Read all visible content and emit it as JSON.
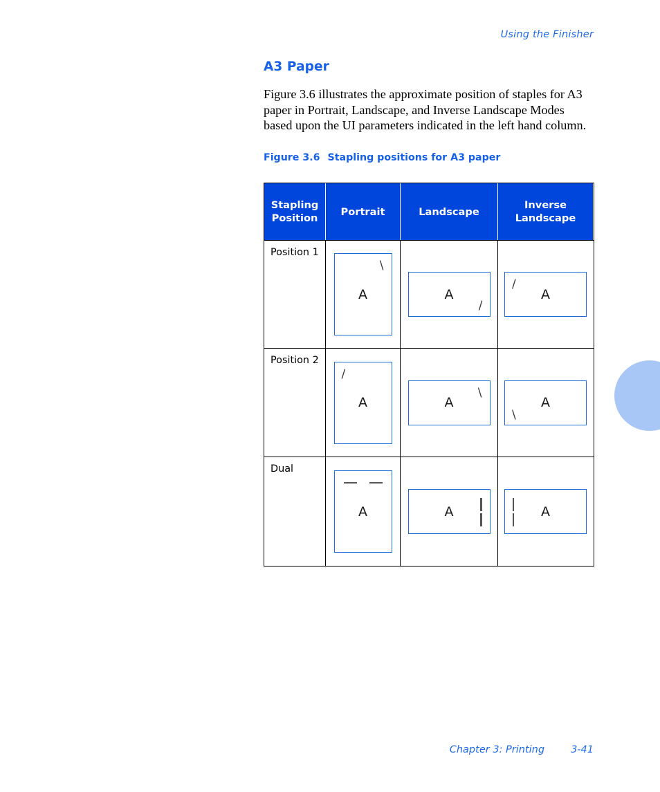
{
  "page": {
    "running_header": "Using the Finisher",
    "heading": "A3 Paper",
    "body": "Figure 3.6 illustrates the approximate position of staples for A3 paper in Portrait, Landscape, and Inverse Landscape Modes based upon the UI parameters indicated in the left hand column.",
    "figure_caption": {
      "number": "Figure 3.6",
      "title": "Stapling positions for A3 paper"
    },
    "footer": {
      "chapter": "Chapter 3: Printing",
      "page_number": "3-41"
    }
  },
  "colors": {
    "heading_blue": "#1661e8",
    "header_band_blue": "#0046dd",
    "sheet_border_blue": "#1a6fd4",
    "margin_circle_blue": "#a9c7f6",
    "staple_gray": "#555555",
    "table_border": "#000000"
  },
  "table": {
    "columns": [
      {
        "label": "Stapling Position"
      },
      {
        "label": "Portrait"
      },
      {
        "label": "Landscape"
      },
      {
        "label": "Inverse Landscape"
      }
    ],
    "rows": [
      {
        "label": "Position 1",
        "portrait": {
          "orientation": "portrait",
          "letter": "A",
          "staples": [
            {
              "glyph": "\\",
              "position": "top-right"
            }
          ]
        },
        "landscape": {
          "orientation": "landscape",
          "letter": "A",
          "staples": [
            {
              "glyph": "/",
              "position": "bottom-right"
            }
          ]
        },
        "inverse": {
          "orientation": "landscape",
          "letter": "A",
          "staples": [
            {
              "glyph": "/",
              "position": "top-left"
            }
          ]
        }
      },
      {
        "label": "Position 2",
        "portrait": {
          "orientation": "portrait",
          "letter": "A",
          "staples": [
            {
              "glyph": "/",
              "position": "top-left"
            }
          ]
        },
        "landscape": {
          "orientation": "landscape",
          "letter": "A",
          "staples": [
            {
              "glyph": "\\",
              "position": "top-right"
            }
          ]
        },
        "inverse": {
          "orientation": "landscape",
          "letter": "A",
          "staples": [
            {
              "glyph": "\\",
              "position": "bottom-left"
            }
          ]
        }
      },
      {
        "label": "Dual",
        "portrait": {
          "orientation": "portrait",
          "letter": "A",
          "staples": [
            {
              "glyph": "bar-horizontal",
              "position": "top-left"
            },
            {
              "glyph": "bar-horizontal",
              "position": "top-right"
            }
          ]
        },
        "landscape": {
          "orientation": "landscape",
          "letter": "A",
          "staples": [
            {
              "glyph": "bar-vertical",
              "position": "right-upper"
            },
            {
              "glyph": "bar-vertical",
              "position": "right-lower"
            }
          ]
        },
        "inverse": {
          "orientation": "landscape",
          "letter": "A",
          "staples": [
            {
              "glyph": "bar-vertical",
              "position": "left-upper"
            },
            {
              "glyph": "bar-vertical",
              "position": "left-lower"
            }
          ]
        }
      }
    ]
  }
}
